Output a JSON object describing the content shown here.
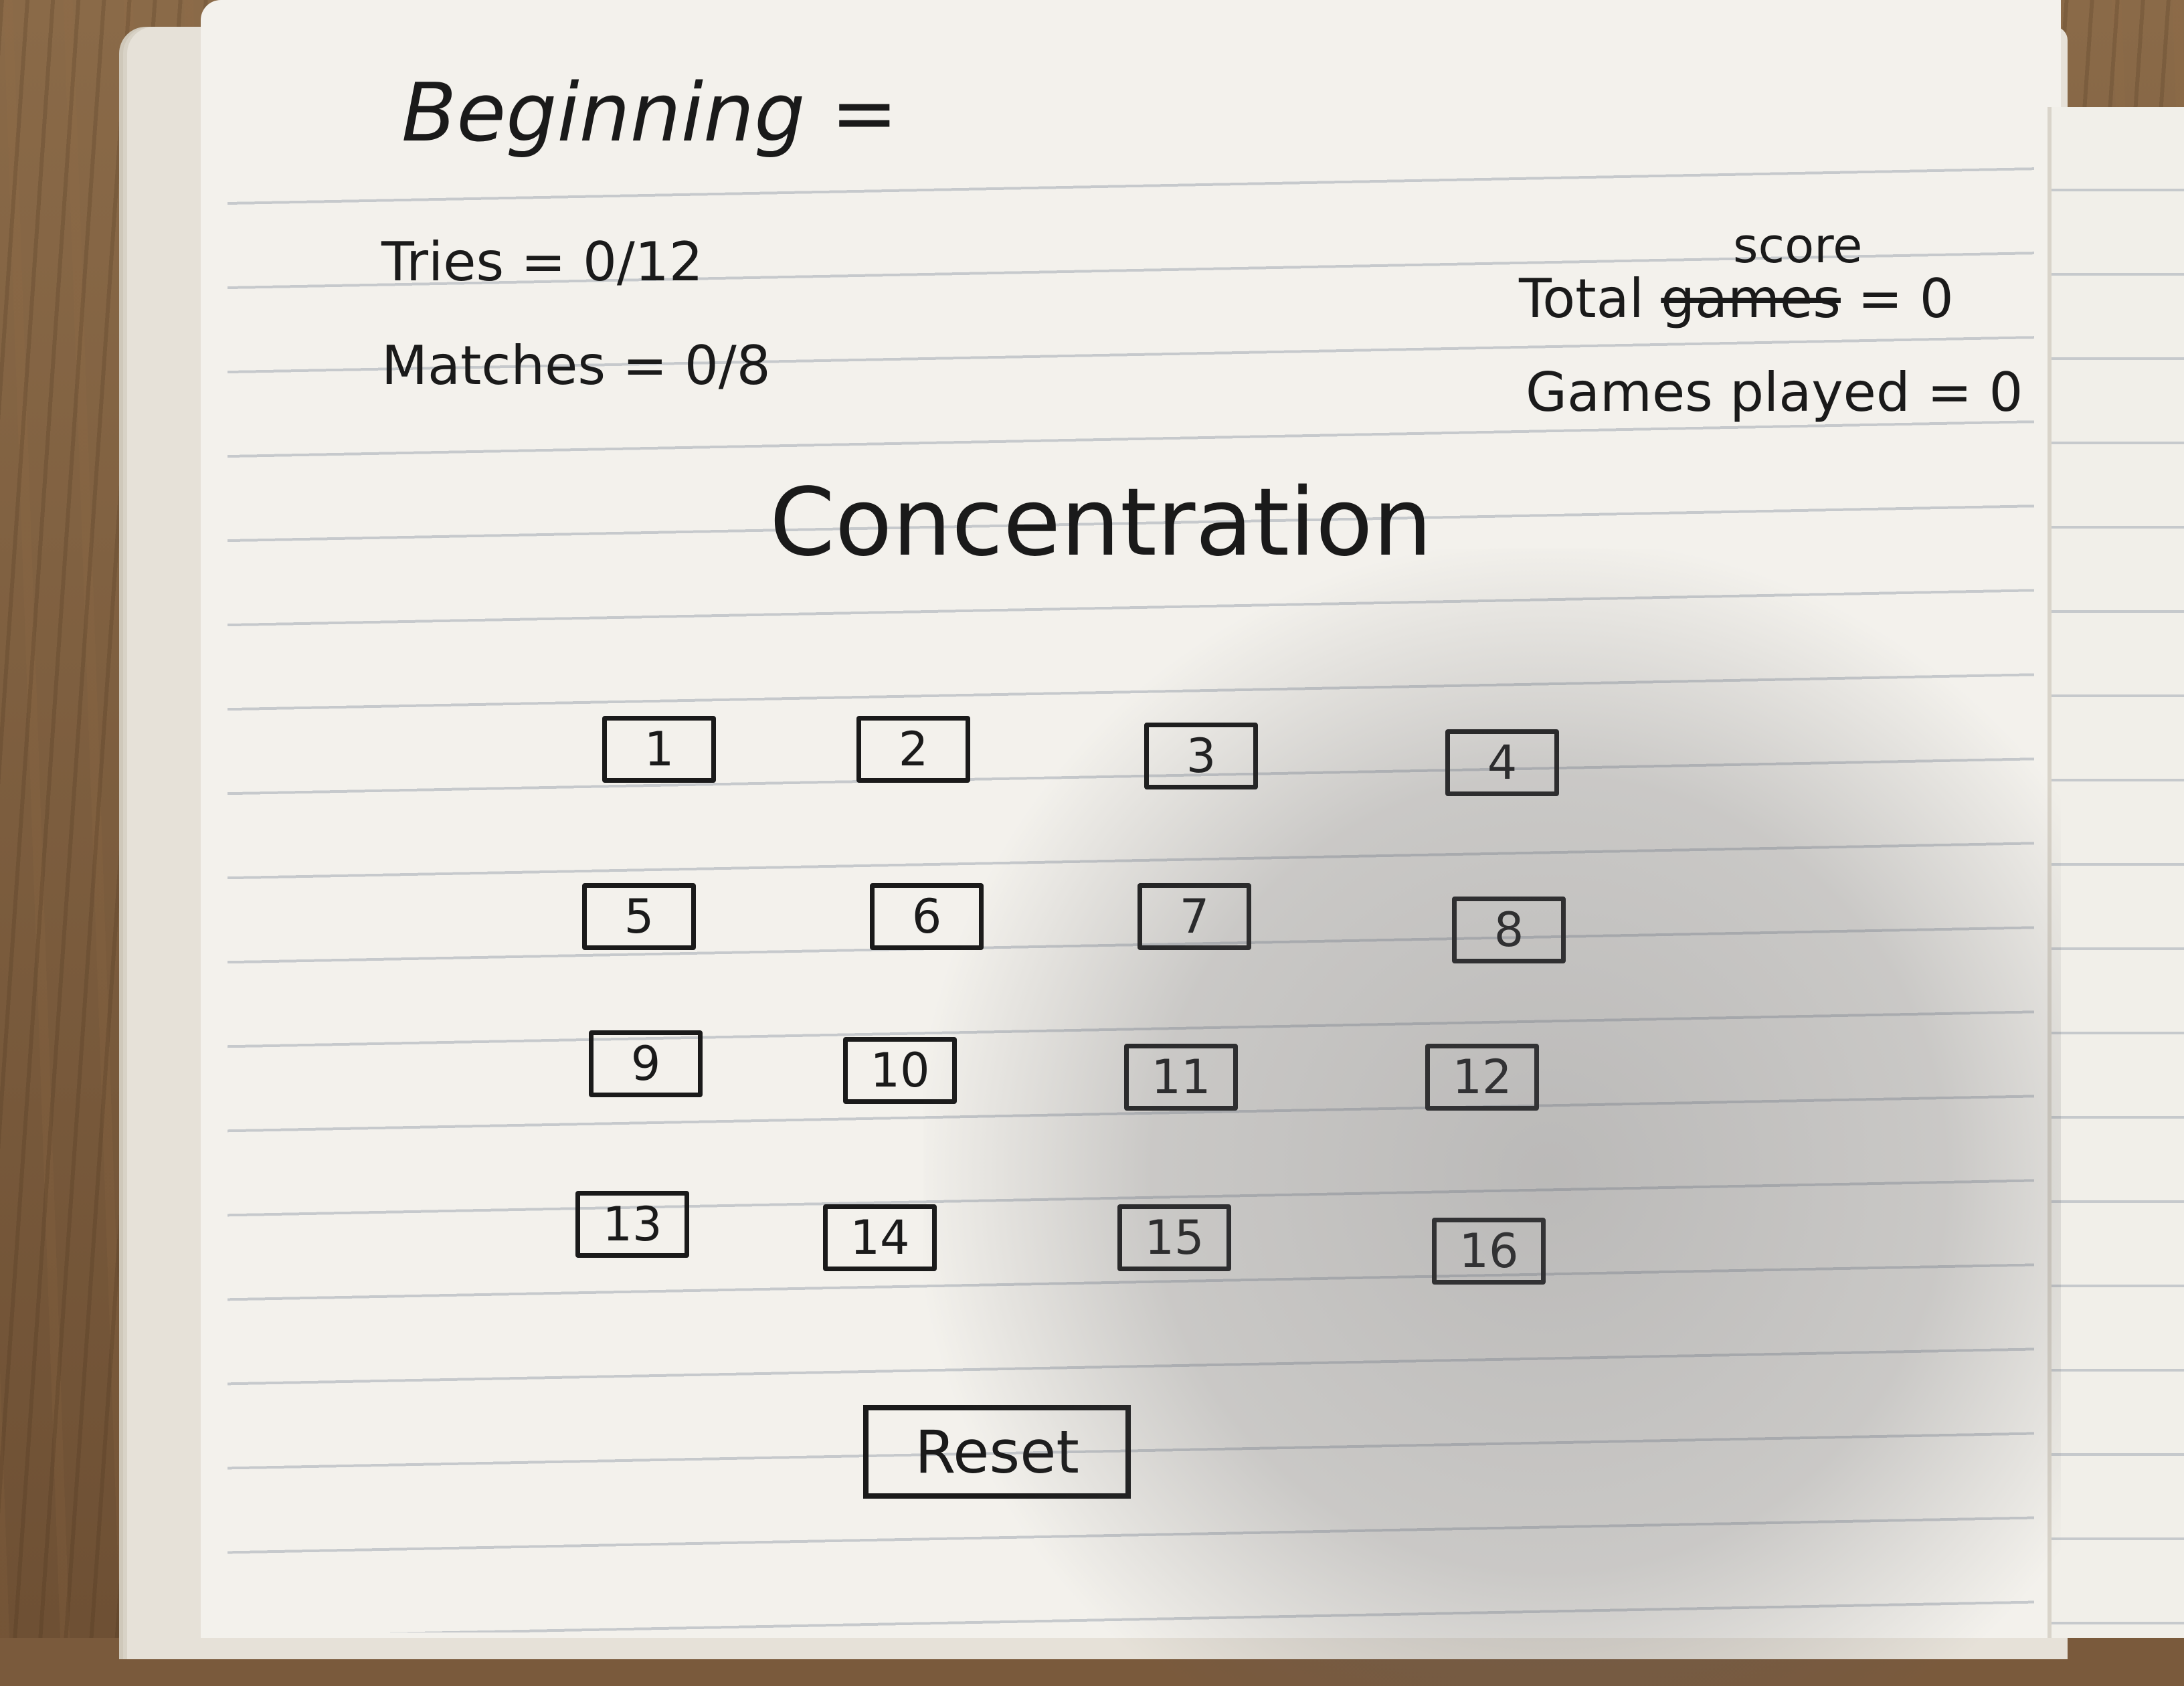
{
  "heading": "Beginning =",
  "stats": {
    "tries": "Tries = 0/12",
    "matches": "Matches = 0/8"
  },
  "score": {
    "note": "score",
    "total_prefix": "Total ",
    "total_struck": "games",
    "total_suffix": " = 0",
    "games_played": "Games played = 0"
  },
  "title": "Concentration",
  "cards": [
    "1",
    "2",
    "3",
    "4",
    "5",
    "6",
    "7",
    "8",
    "9",
    "10",
    "11",
    "12",
    "13",
    "14",
    "15",
    "16"
  ],
  "reset_label": "Reset"
}
